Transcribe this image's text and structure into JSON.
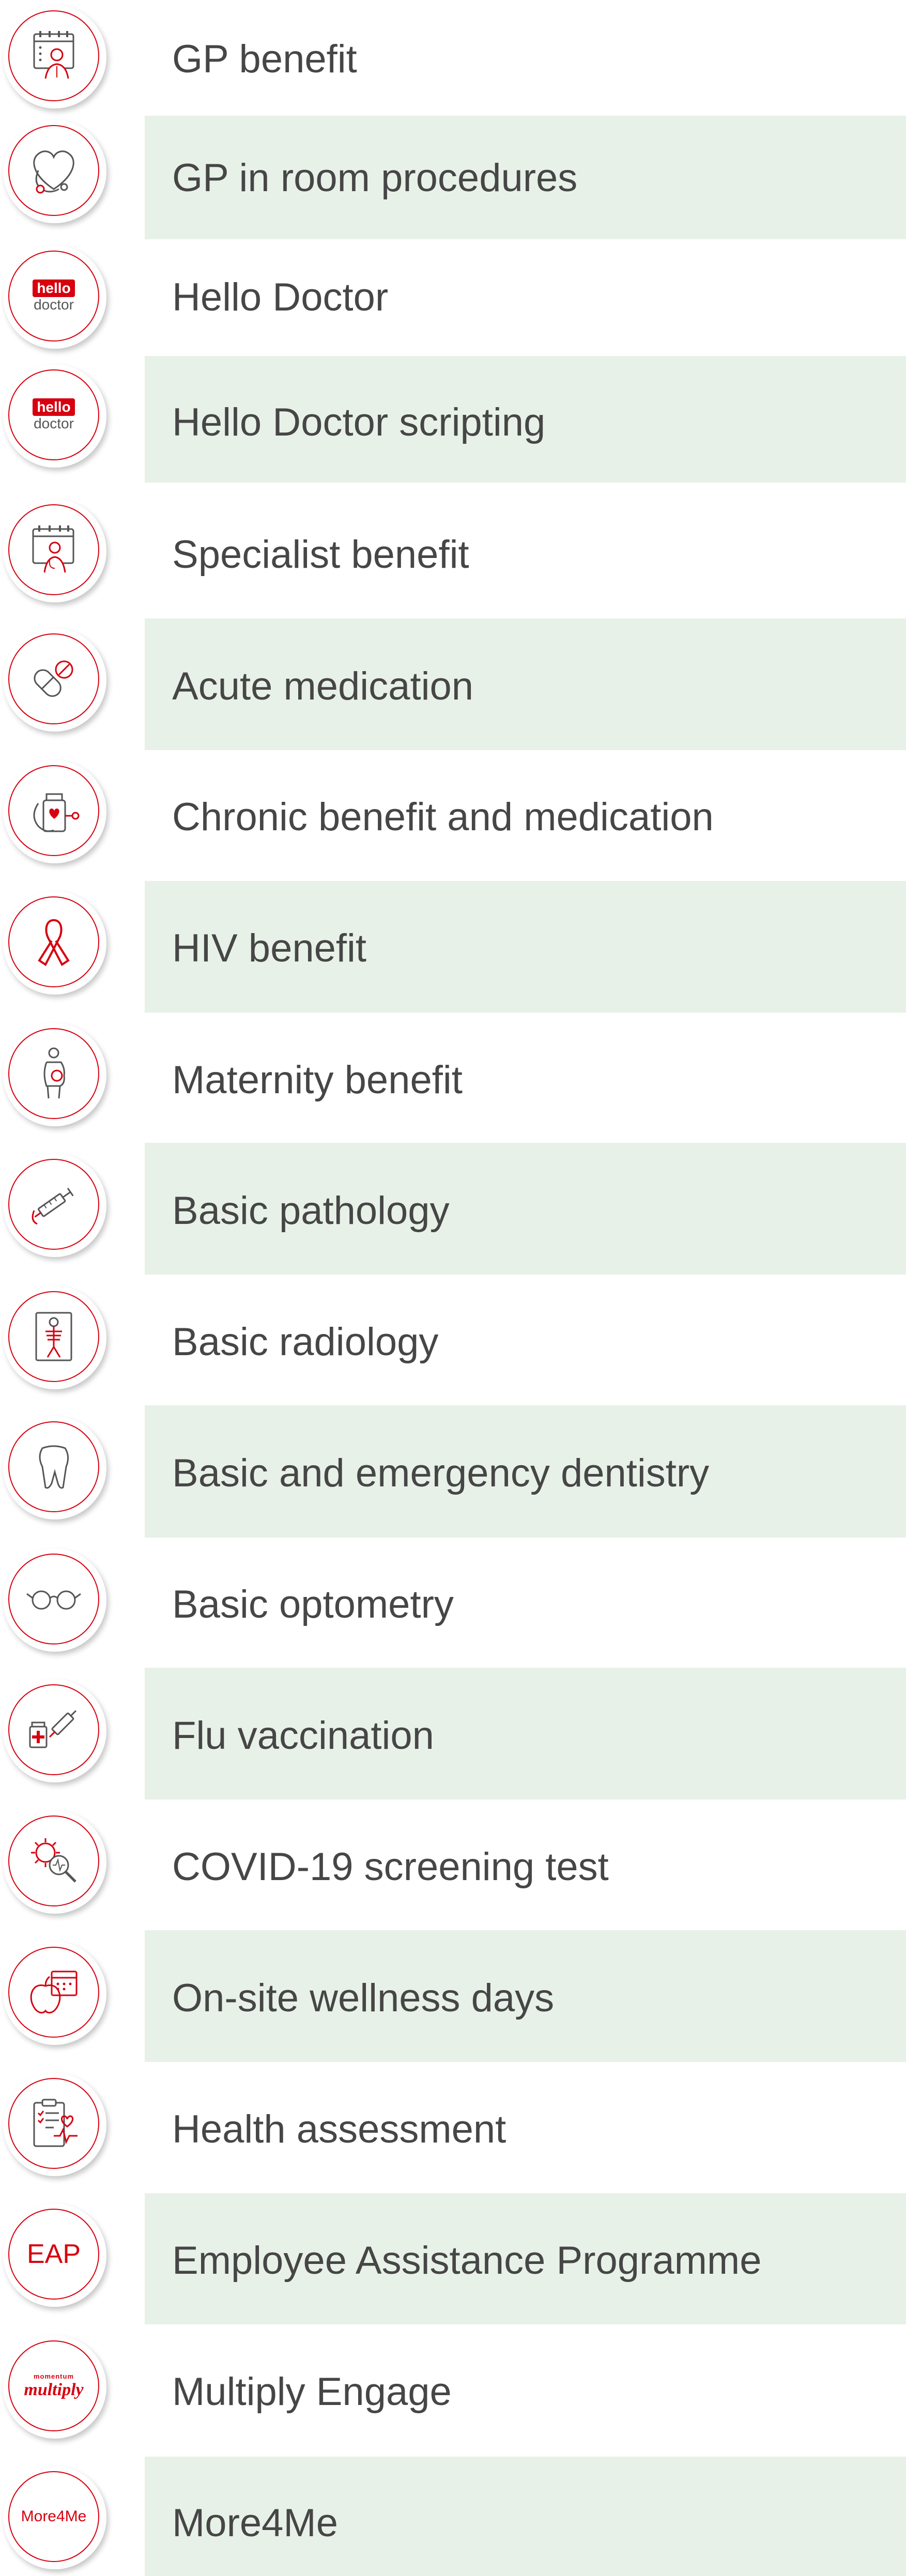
{
  "colors": {
    "accent": "#d7000f",
    "band": "#e8f1e8",
    "text": "#464646"
  },
  "benefits": [
    {
      "label": "GP benefit",
      "icon": "doctor-calendar-icon"
    },
    {
      "label": "GP in room procedures",
      "icon": "stethoscope-heart-icon"
    },
    {
      "label": "Hello Doctor",
      "icon": "hello-doctor-logo-icon",
      "logo_top": "hello",
      "logo_bottom": "doctor"
    },
    {
      "label": "Hello Doctor scripting",
      "icon": "hello-doctor-logo-icon",
      "logo_top": "hello",
      "logo_bottom": "doctor"
    },
    {
      "label": "Specialist benefit",
      "icon": "specialist-calendar-icon"
    },
    {
      "label": "Acute medication",
      "icon": "pills-icon"
    },
    {
      "label": "Chronic benefit and medication",
      "icon": "medication-bottle-stethoscope-icon"
    },
    {
      "label": "HIV benefit",
      "icon": "awareness-ribbon-icon"
    },
    {
      "label": "Maternity benefit",
      "icon": "pregnant-woman-icon"
    },
    {
      "label": "Basic pathology",
      "icon": "syringe-icon"
    },
    {
      "label": "Basic radiology",
      "icon": "xray-icon"
    },
    {
      "label": "Basic and emergency dentistry",
      "icon": "tooth-icon"
    },
    {
      "label": "Basic optometry",
      "icon": "glasses-icon"
    },
    {
      "label": "Flu vaccination",
      "icon": "vaccine-icon"
    },
    {
      "label": "COVID-19 screening test",
      "icon": "virus-magnifier-icon"
    },
    {
      "label": "On-site wellness days",
      "icon": "apple-calendar-icon"
    },
    {
      "label": "Health assessment",
      "icon": "clipboard-heartbeat-icon"
    },
    {
      "label": "Employee Assistance Programme",
      "icon": "eap-text-icon",
      "icon_text": "EAP"
    },
    {
      "label": "Multiply Engage",
      "icon": "multiply-logo-icon",
      "logo_top": "momentum",
      "logo_bottom": "multiply"
    },
    {
      "label": "More4Me",
      "icon": "more4me-text-icon",
      "icon_text": "More4Me"
    }
  ]
}
